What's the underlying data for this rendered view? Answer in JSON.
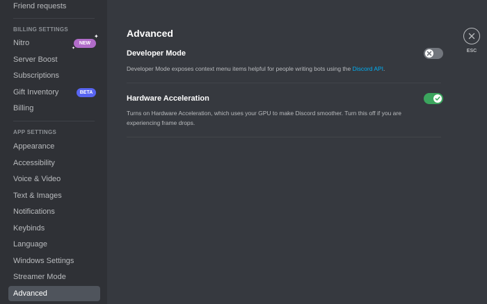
{
  "sidebar": {
    "top_item": "Friend requests",
    "billing_header": "BILLING SETTINGS",
    "billing_items": [
      {
        "label": "Nitro",
        "badge": "NEW"
      },
      {
        "label": "Server Boost"
      },
      {
        "label": "Subscriptions"
      },
      {
        "label": "Gift Inventory",
        "badge": "BETA"
      },
      {
        "label": "Billing"
      }
    ],
    "app_header": "APP SETTINGS",
    "app_items": [
      "Appearance",
      "Accessibility",
      "Voice & Video",
      "Text & Images",
      "Notifications",
      "Keybinds",
      "Language",
      "Windows Settings",
      "Streamer Mode",
      "Advanced"
    ],
    "selected": "Advanced"
  },
  "main": {
    "title": "Advanced",
    "settings": [
      {
        "title": "Developer Mode",
        "description": "Developer Mode exposes context menu items helpful for people writing bots using the",
        "link_text": "Discord API",
        "link_suffix": ".",
        "enabled": false
      },
      {
        "title": "Hardware Acceleration",
        "description": "Turns on Hardware Acceleration, which uses your GPU to make Discord smoother. Turn this off if you are experiencing frame drops.",
        "enabled": true
      }
    ]
  },
  "close": {
    "label": "ESC",
    "icon": "close-icon"
  },
  "colors": {
    "sidebar_bg": "#2f3136",
    "main_bg": "#36393f",
    "selected_bg": "#4f545c",
    "toggle_on": "#3ba55d",
    "toggle_off": "#72767d",
    "link": "#00aff4",
    "badge_new": "#b16cc9",
    "badge_beta": "#5865f2"
  }
}
